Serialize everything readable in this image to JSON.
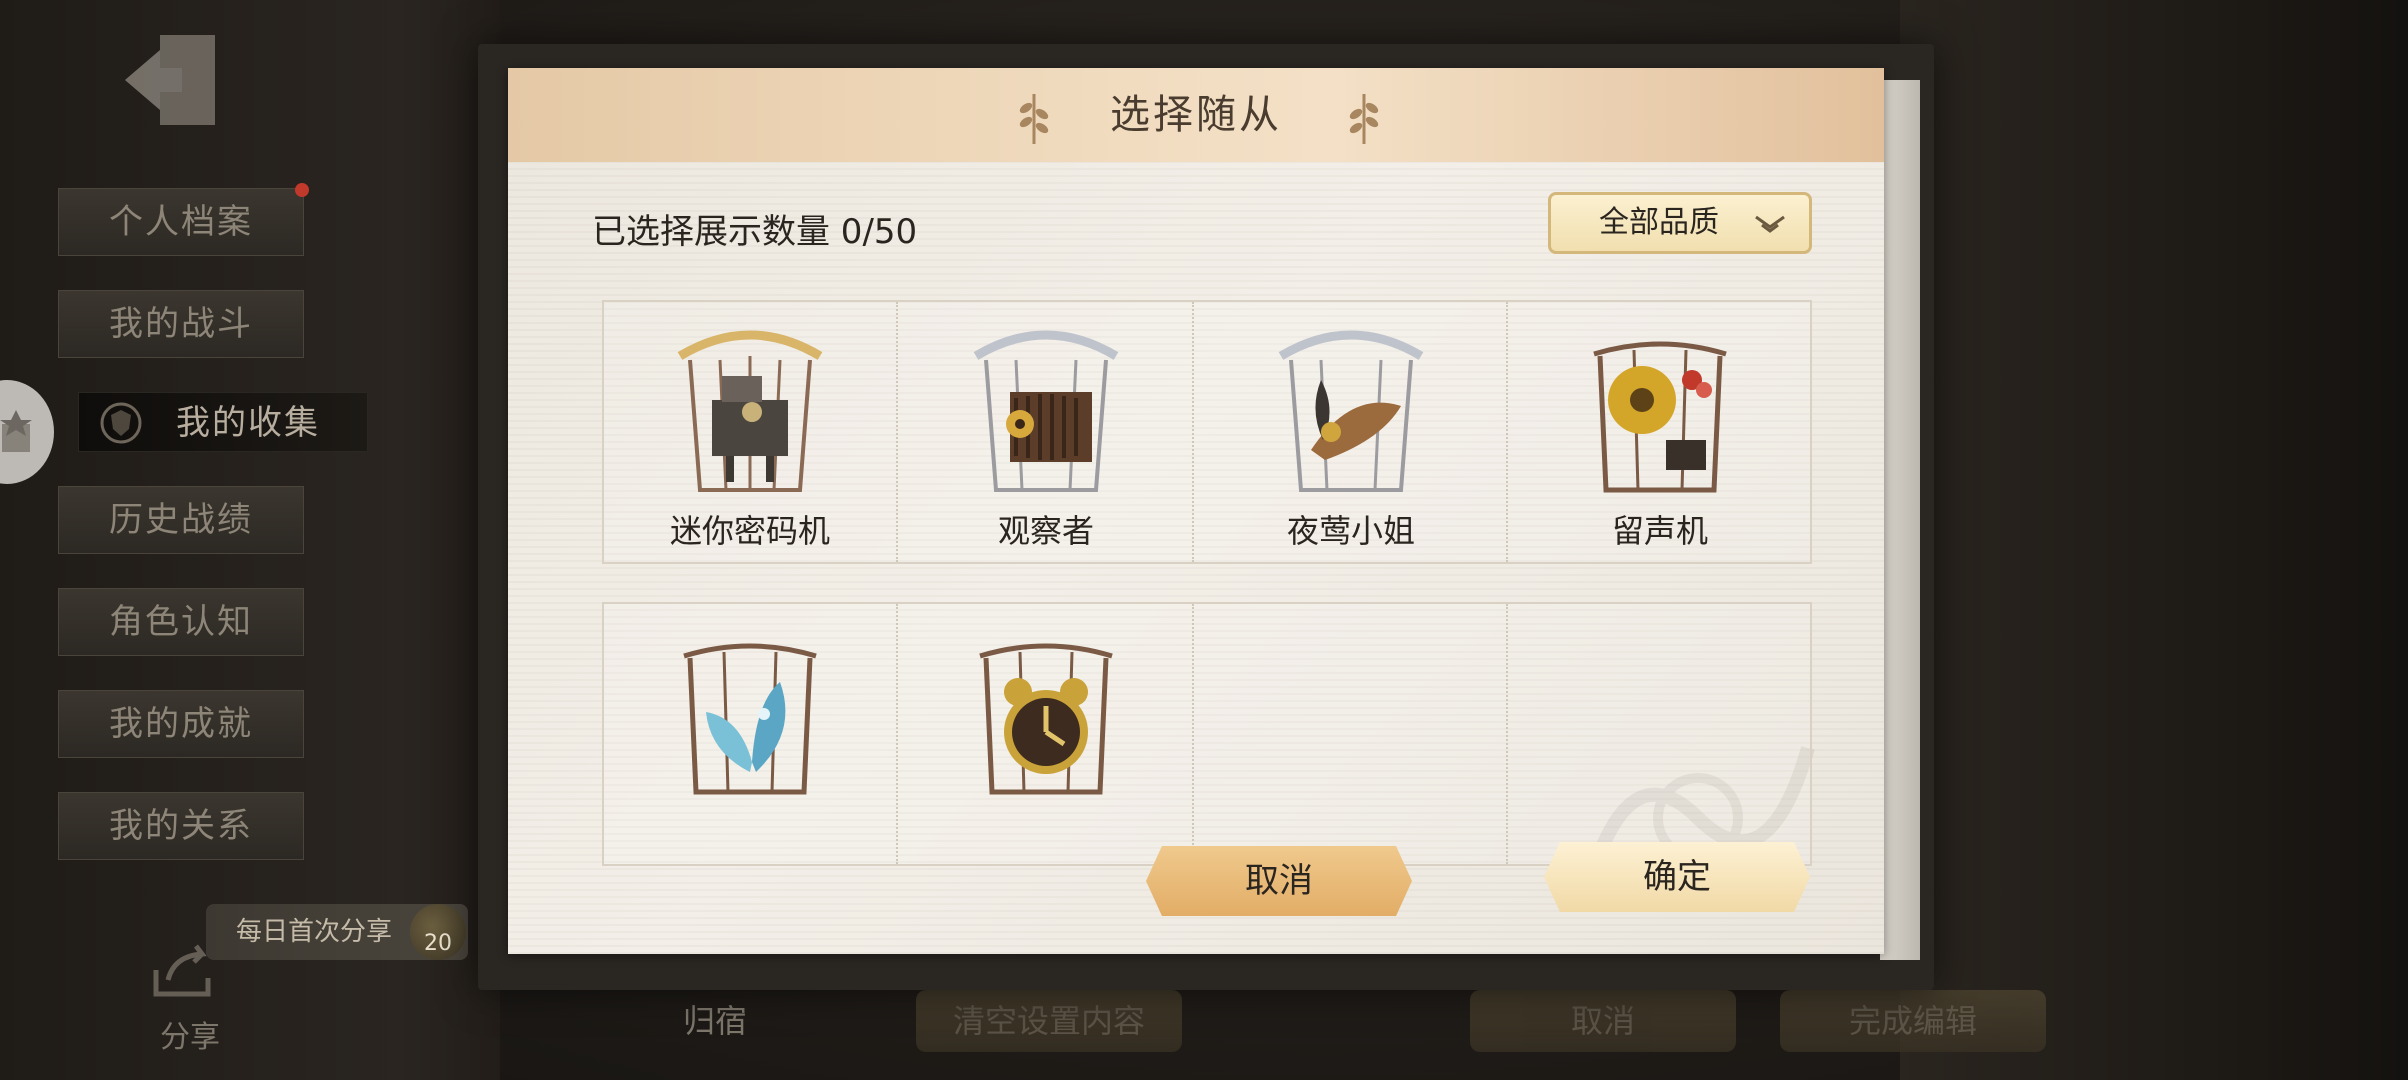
{
  "side_nav": {
    "items": [
      {
        "label": "个人档案",
        "badge": true
      },
      {
        "label": "我的战斗"
      },
      {
        "label": "我的收集",
        "active": true
      },
      {
        "label": "历史战绩"
      },
      {
        "label": "角色认知"
      },
      {
        "label": "我的成就"
      },
      {
        "label": "我的关系"
      }
    ]
  },
  "share": {
    "pill_label": "每日首次分享",
    "coin_count": "20",
    "label": "分享"
  },
  "bottom_bar": {
    "return_label": "归宿",
    "clear_label": "清空设置内容",
    "cancel_label": "取消",
    "finish_label": "完成编辑"
  },
  "dialog": {
    "title": "选择随从",
    "count_label": "已选择展示数量 0/50",
    "quality_filter": "全部品质",
    "followers": [
      {
        "name": "迷你密码机"
      },
      {
        "name": "观察者"
      },
      {
        "name": "夜莺小姐"
      },
      {
        "name": "留声机"
      },
      {
        "name": ""
      },
      {
        "name": ""
      }
    ],
    "cancel_button": "取消",
    "confirm_button": "确定"
  }
}
